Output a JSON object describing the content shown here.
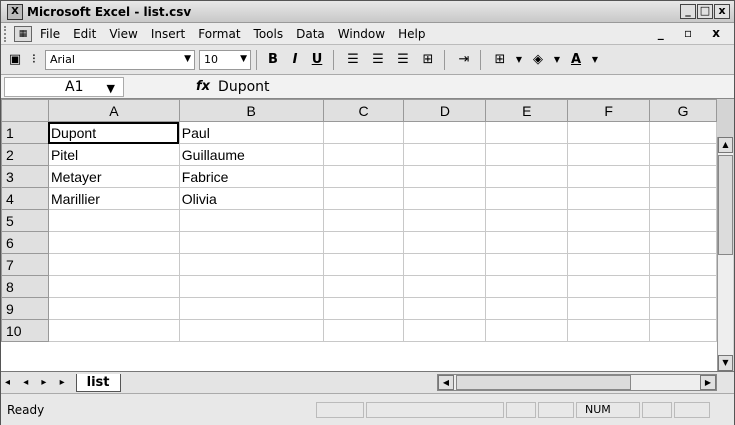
{
  "window": {
    "title": "Microsoft Excel - list.csv",
    "buttons": [
      "_",
      "□",
      "x"
    ]
  },
  "menu": {
    "items": [
      "File",
      "Edit",
      "View",
      "Insert",
      "Format",
      "Tools",
      "Data",
      "Window",
      "Help"
    ],
    "doc_controls": "_ ▫ x"
  },
  "toolbar": {
    "font_name": "Arial",
    "font_size": "10",
    "bold": "B",
    "italic": "I",
    "underline": "U",
    "font_color_glyph": "A"
  },
  "formula_bar": {
    "cell_ref": "A1",
    "fx": "fx",
    "content": "Dupont"
  },
  "sheet": {
    "columns": [
      "A",
      "B",
      "C",
      "D",
      "E",
      "F",
      "G"
    ],
    "rows": [
      {
        "n": "1",
        "a": "Dupont",
        "b": "Paul"
      },
      {
        "n": "2",
        "a": "Pitel",
        "b": "Guillaume"
      },
      {
        "n": "3",
        "a": "Metayer",
        "b": "Fabrice"
      },
      {
        "n": "4",
        "a": "Marillier",
        "b": "Olivia"
      },
      {
        "n": "5",
        "a": "",
        "b": ""
      },
      {
        "n": "6",
        "a": "",
        "b": ""
      },
      {
        "n": "7",
        "a": "",
        "b": ""
      },
      {
        "n": "8",
        "a": "",
        "b": ""
      },
      {
        "n": "9",
        "a": "",
        "b": ""
      },
      {
        "n": "10",
        "a": "",
        "b": ""
      }
    ]
  },
  "tabs": {
    "nav": "◂ ◂ ▸ ▸",
    "active": "list"
  },
  "status": {
    "text": "Ready",
    "num": "NUM"
  }
}
